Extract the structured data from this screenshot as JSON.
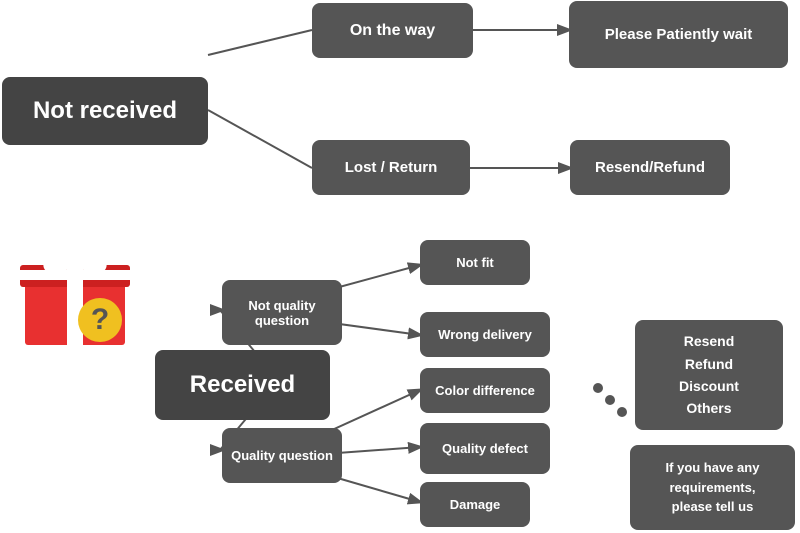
{
  "nodes": {
    "not_received": {
      "label": "Not received"
    },
    "on_the_way": {
      "label": "On the way"
    },
    "please_wait": {
      "label": "Please Patiently wait"
    },
    "lost_return": {
      "label": "Lost / Return"
    },
    "resend_refund_top": {
      "label": "Resend/Refund"
    },
    "received": {
      "label": "Received"
    },
    "not_quality_question": {
      "label": "Not quality\nquestion"
    },
    "not_fit": {
      "label": "Not fit"
    },
    "wrong_delivery": {
      "label": "Wrong delivery"
    },
    "quality_question": {
      "label": "Quality question"
    },
    "color_difference": {
      "label": "Color difference"
    },
    "quality_defect": {
      "label": "Quality defect"
    },
    "damage": {
      "label": "Damage"
    },
    "resend_refund_options": {
      "label": "Resend\nRefund\nDiscount\nOthers"
    },
    "if_requirements": {
      "label": "If you have any\nrequirements,\nplease tell us"
    }
  }
}
